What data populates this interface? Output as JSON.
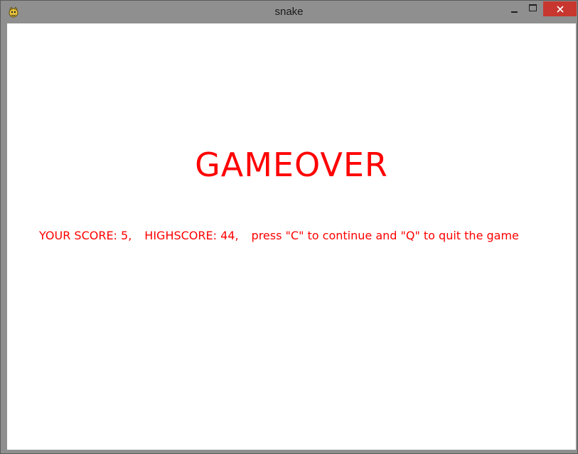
{
  "window": {
    "title": "snake",
    "icon": "pygame-snake-icon",
    "close_color": "#c7372f"
  },
  "game": {
    "headline": "GAMEOVER",
    "score_text": "YOUR SCORE: 5,",
    "highscore_text": "HIGHSCORE: 44,",
    "instructions": "press \"C\" to continue and \"Q\" to quit the game",
    "text_color": "#ff0000",
    "background": "#ffffff"
  }
}
